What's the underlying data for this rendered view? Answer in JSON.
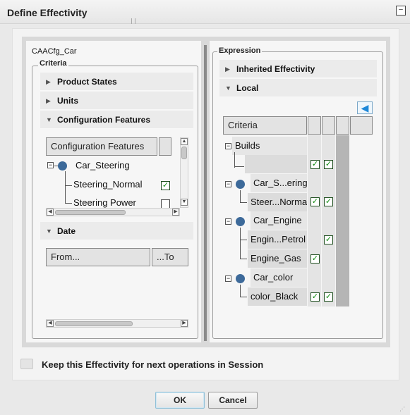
{
  "window": {
    "title": "Define Effectivity",
    "minimize_glyph": "–"
  },
  "left": {
    "product_name": "CAACfg_Car",
    "criteria_group": "Criteria",
    "sections": {
      "product_states": "Product States",
      "units": "Units",
      "configuration_features": "Configuration Features",
      "date": "Date"
    },
    "cf_table": {
      "header": "Configuration Features",
      "root": "Car_Steering",
      "rows": [
        {
          "label": "Steering_Normal",
          "checked": true
        },
        {
          "label": "Steering Power",
          "checked": false
        }
      ]
    },
    "date_table": {
      "from": "From...",
      "to": "...To"
    }
  },
  "right": {
    "expression_group": "Expression",
    "sections": {
      "inherited": "Inherited Effectivity",
      "local": "Local"
    },
    "table_header": "Criteria",
    "rows": [
      {
        "label": "Builds",
        "type": "group-plain"
      },
      {
        "label": "",
        "type": "leaf",
        "c1": true,
        "c2": true
      },
      {
        "label": "Car_S...ering",
        "type": "group"
      },
      {
        "label": "Steer...Norma",
        "type": "leaf",
        "c1": true,
        "c2": true
      },
      {
        "label": "Car_Engine",
        "type": "group"
      },
      {
        "label": "Engin...Petrol",
        "type": "leaf",
        "c1": false,
        "c2": true
      },
      {
        "label": "Engine_Gas",
        "type": "leaf",
        "c1": true,
        "c2": false
      },
      {
        "label": "Car_color",
        "type": "group"
      },
      {
        "label": "color_Black",
        "type": "leaf",
        "c1": true,
        "c2": true
      }
    ]
  },
  "footer": {
    "keep_label": "Keep this Effectivity for next operations in Session",
    "ok": "OK",
    "cancel": "Cancel"
  },
  "glyphs": {
    "check": "✓",
    "collapsed": "▶",
    "expanded": "▼",
    "minus": "−",
    "left": "◀",
    "right": "▶",
    "up": "▲",
    "down": "▼"
  },
  "colors": {
    "node_blue": "#3d6a9a",
    "check_green": "#0a8a0a",
    "back_arrow": "#1e88d8"
  }
}
